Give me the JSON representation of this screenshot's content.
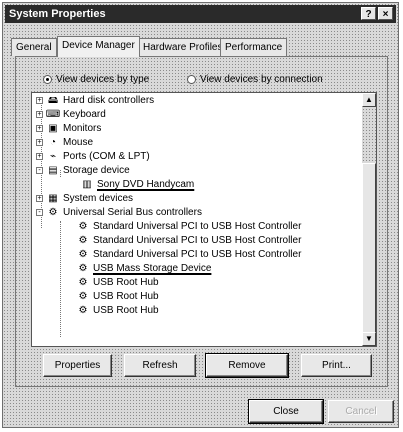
{
  "window": {
    "title": "System Properties",
    "help_button": "?",
    "close_button": "×"
  },
  "tabs": [
    {
      "label": "General",
      "active": false
    },
    {
      "label": "Device Manager",
      "active": true
    },
    {
      "label": "Hardware Profiles",
      "active": false
    },
    {
      "label": "Performance",
      "active": false
    }
  ],
  "view": {
    "by_type_label": "View devices by type",
    "by_connection_label": "View devices by connection",
    "selected": "by_type"
  },
  "tree": {
    "items": [
      {
        "label": "Hard disk controllers",
        "icon": "hard-disk-controller-icon",
        "expander": "+"
      },
      {
        "label": "Keyboard",
        "icon": "keyboard-icon",
        "expander": "+"
      },
      {
        "label": "Monitors",
        "icon": "monitor-icon",
        "expander": "+"
      },
      {
        "label": "Mouse",
        "icon": "mouse-icon",
        "expander": "+"
      },
      {
        "label": "Ports (COM & LPT)",
        "icon": "port-icon",
        "expander": "+"
      },
      {
        "label": "Storage device",
        "icon": "storage-device-icon",
        "expander": "-"
      },
      {
        "label": "Sony DVD Handycam",
        "icon": "camcorder-icon",
        "expander": "",
        "underlined": true
      },
      {
        "label": "System devices",
        "icon": "system-devices-icon",
        "expander": "+"
      },
      {
        "label": "Universal Serial Bus controllers",
        "icon": "usb-icon",
        "expander": "-"
      },
      {
        "label": "Standard Universal PCI to USB Host Controller",
        "icon": "usb-icon",
        "expander": ""
      },
      {
        "label": "Standard Universal PCI to USB Host Controller",
        "icon": "usb-icon",
        "expander": ""
      },
      {
        "label": "Standard Universal PCI to USB Host Controller",
        "icon": "usb-icon",
        "expander": ""
      },
      {
        "label": "USB Mass Storage Device",
        "icon": "usb-icon",
        "expander": "",
        "underlined": true
      },
      {
        "label": "USB Root Hub",
        "icon": "usb-icon",
        "expander": ""
      },
      {
        "label": "USB Root Hub",
        "icon": "usb-icon",
        "expander": ""
      },
      {
        "label": "USB Root Hub",
        "icon": "usb-icon",
        "expander": ""
      }
    ]
  },
  "buttons": {
    "properties": "Properties",
    "refresh": "Refresh",
    "remove": "Remove",
    "print": "Print...",
    "close": "Close",
    "cancel": "Cancel"
  },
  "colors": {
    "titlebar": "#2a2a2a",
    "face": "#d9d9d9",
    "list_bg": "#ffffff"
  }
}
